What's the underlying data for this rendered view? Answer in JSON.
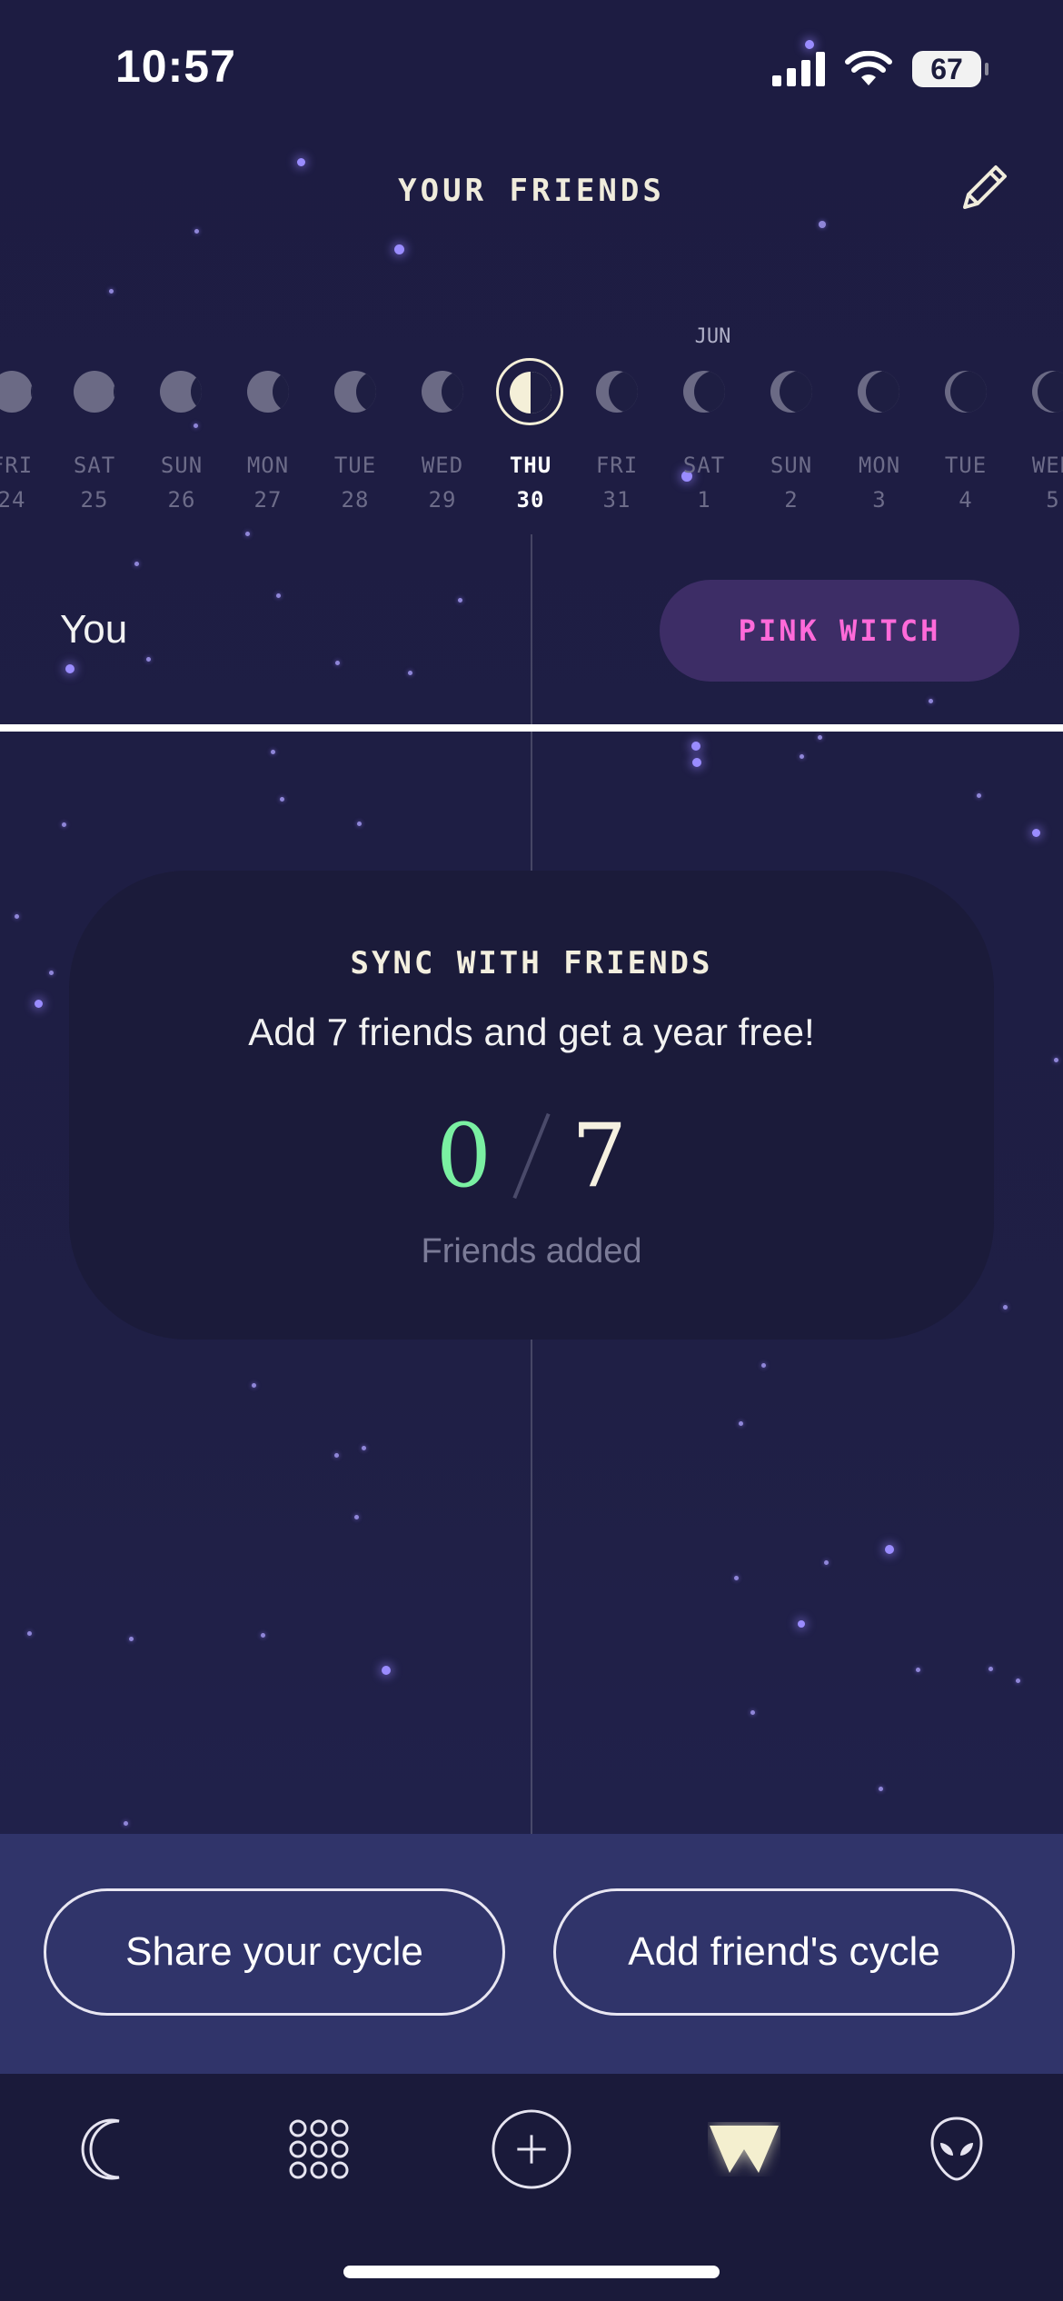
{
  "status_bar": {
    "time": "10:57",
    "battery": "67"
  },
  "header": {
    "title": "YOUR FRIENDS",
    "edit_icon": "pencil-icon"
  },
  "calendar": {
    "month_label": "JUN",
    "days": [
      {
        "day": "FRI",
        "date": "24"
      },
      {
        "day": "SAT",
        "date": "25"
      },
      {
        "day": "SUN",
        "date": "26"
      },
      {
        "day": "MON",
        "date": "27"
      },
      {
        "day": "TUE",
        "date": "28"
      },
      {
        "day": "WED",
        "date": "29"
      },
      {
        "day": "THU",
        "date": "30"
      },
      {
        "day": "FRI",
        "date": "31"
      },
      {
        "day": "SAT",
        "date": "1"
      },
      {
        "day": "SUN",
        "date": "2"
      },
      {
        "day": "MON",
        "date": "3"
      },
      {
        "day": "TUE",
        "date": "4"
      },
      {
        "day": "WED",
        "date": "5"
      }
    ],
    "selected": "THU 30"
  },
  "friends_row": {
    "you_label": "You",
    "friend_name": "PINK WITCH"
  },
  "sync_card": {
    "title": "SYNC WITH FRIENDS",
    "subtitle": "Add 7 friends and get a year free!",
    "added": "0",
    "goal": "7",
    "footer": "Friends added"
  },
  "actions": {
    "share": "Share your cycle",
    "add": "Add friend's cycle"
  },
  "tabs": [
    "moon-icon",
    "grid-dots-icon",
    "plus-circle-icon",
    "witch-w-icon",
    "alien-icon"
  ],
  "colors": {
    "accent_green": "#7af0a2",
    "accent_pink": "#ff6ad9",
    "background": "#1e1e42"
  }
}
